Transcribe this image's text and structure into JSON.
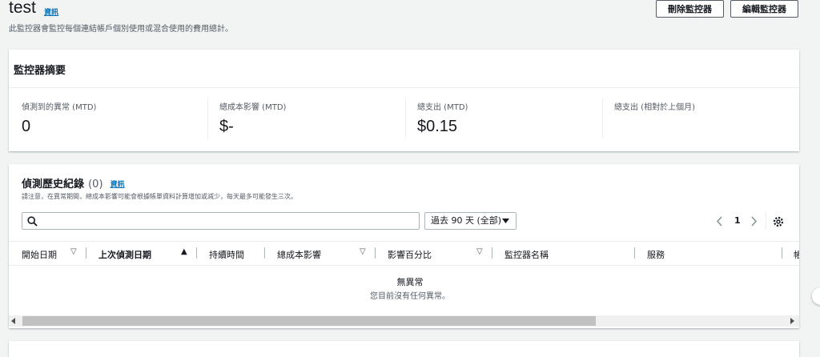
{
  "header": {
    "title": "test",
    "info": "資訊",
    "subtitle": "此監控器會監控每個連結帳戶個別使用或混合使用的費用總計。",
    "delete_button": "刪除監控器",
    "edit_button": "編輯監控器"
  },
  "summary": {
    "title": "監控器摘要",
    "metrics": [
      {
        "label": "偵測到的異常 (MTD)",
        "value": "0"
      },
      {
        "label": "總成本影響 (MTD)",
        "value": "$-"
      },
      {
        "label": "總支出 (MTD)",
        "value": "$0.15"
      },
      {
        "label": "總支出 (相對於上個月)",
        "value": ""
      }
    ]
  },
  "history": {
    "title": "偵測歷史紀錄",
    "count": "(0)",
    "info": "資訊",
    "note": "請注意，在異常期間，總成本影響可能會根據帳單資料計算增加或減少，每天最多可能發生三次。",
    "search_placeholder": "",
    "range_select": "過去 90 天 (全部)",
    "page": "1",
    "columns": [
      "開始日期",
      "上次偵測日期",
      "持續時間",
      "總成本影響",
      "影響百分比",
      "監控器名稱",
      "服務",
      "帳"
    ],
    "empty_title": "無異常",
    "empty_desc": "您目前沒有任何異常。"
  },
  "colors": {
    "accent": "#0073bb",
    "border": "#aab7b8",
    "background": "#f2f3f3"
  }
}
